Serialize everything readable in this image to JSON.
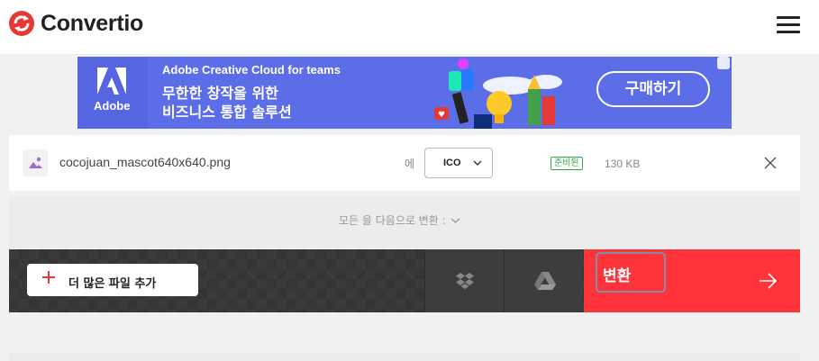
{
  "header": {
    "brand_name": "Convertio",
    "logo_color": "#e53935"
  },
  "ad": {
    "advertiser": "Adobe",
    "title": "Adobe Creative Cloud for teams",
    "line1": "무한한 창작을 위한",
    "line2": "비즈니스 통합 솔루션",
    "cta_label": "구매하기",
    "background_color": "#5b6ee8"
  },
  "file": {
    "name": "cocojuan_mascot640x640.png",
    "to_label": "에",
    "target_format": "ICO",
    "status": "준비된",
    "size": "130 KB",
    "icon": "image-icon",
    "status_color": "#2fa84a"
  },
  "convert_all": {
    "label": "모든 을 다음으로 변환 :"
  },
  "actions": {
    "add_files_label": "더 많은 파일 추가",
    "dropbox_icon": "dropbox-icon",
    "gdrive_icon": "google-drive-icon",
    "convert_label": "변환",
    "convert_color": "#ff333a"
  }
}
